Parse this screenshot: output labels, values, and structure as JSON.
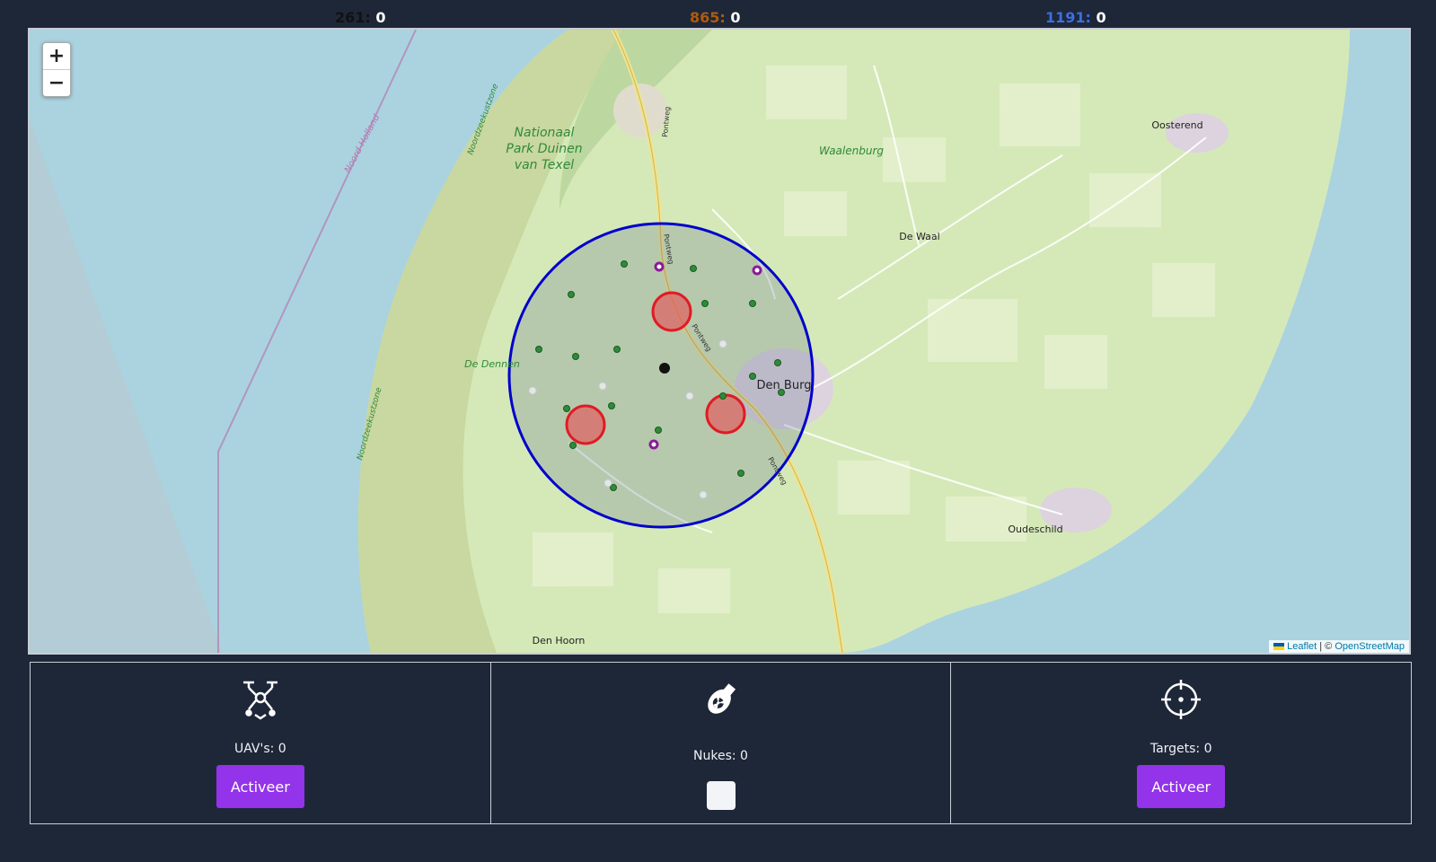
{
  "scores": [
    {
      "label": "261:",
      "value": "0",
      "color": "#111111"
    },
    {
      "label": "865:",
      "value": "0",
      "color": "#b05a0c"
    },
    {
      "label": "1191:",
      "value": "0",
      "color": "#3b6fe0"
    }
  ],
  "map": {
    "zoom_in": "+",
    "zoom_out": "−",
    "labels": {
      "park": [
        "Nationaal",
        "Park Duinen",
        "van Texel"
      ],
      "waalenburg": "Waalenburg",
      "oosterend": "Oosterend",
      "de_waal": "De Waal",
      "den_burg": "Den Burg",
      "de_dennen": "De Dennen",
      "oudeschild": "Oudeschild",
      "den_hoorn": "Den Hoorn",
      "noord_holland": "Noord-Holland",
      "noordzeekustzone_1": "Noordzeekustzone",
      "noordzeekustzone_2": "Noordzeekustzone",
      "pontweg_1": "Pontweg",
      "pontweg_2": "Pontweg",
      "pontweg_3": "Pontweg",
      "pontweg_4": "Pontweg"
    },
    "attribution": {
      "leaflet": "Leaflet",
      "separator": " | © ",
      "osm": "OpenStreetMap"
    },
    "range_circle_color": "#0000cc",
    "threat_color": "#e01b24"
  },
  "panels": {
    "uav": {
      "caption": "UAV's: 0",
      "button": "Activeer",
      "icon": "drone-icon"
    },
    "nukes": {
      "caption": "Nukes: 0",
      "icon": "nuke-bomb-icon"
    },
    "targets": {
      "caption": "Targets: 0",
      "button": "Activeer",
      "icon": "crosshair-icon"
    }
  },
  "accent_color": "#9333ea"
}
